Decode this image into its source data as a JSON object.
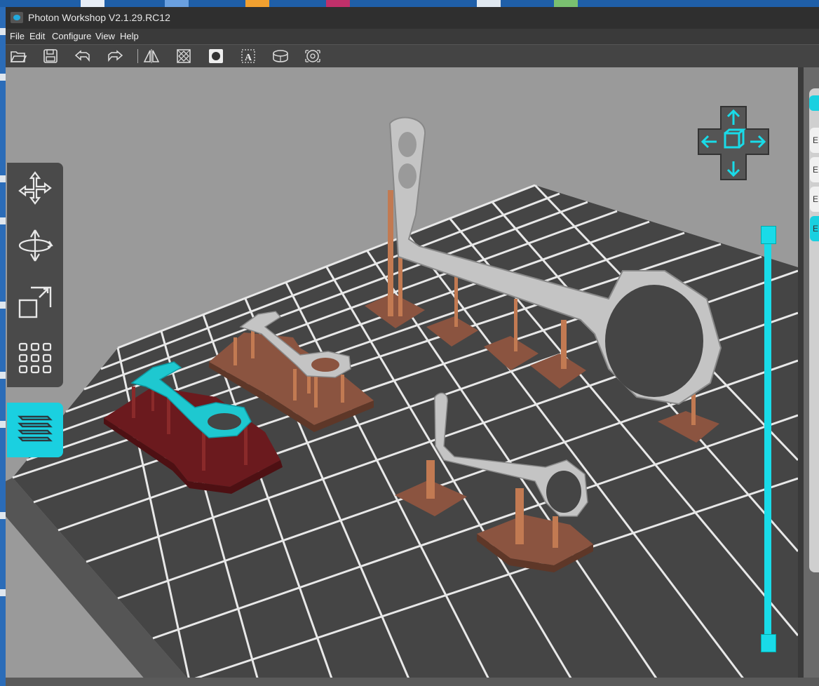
{
  "window": {
    "title": "Photon Workshop V2.1.29.RC12"
  },
  "menu": [
    "File",
    "Edit",
    "Configure",
    "View",
    "Help"
  ],
  "toolbar": [
    {
      "name": "open-icon"
    },
    {
      "name": "save-icon"
    },
    {
      "name": "undo-icon"
    },
    {
      "name": "redo-icon"
    },
    {
      "name": "mirror-icon"
    },
    {
      "name": "hollow-icon"
    },
    {
      "name": "punch-hole-icon"
    },
    {
      "name": "text-icon"
    },
    {
      "name": "slice-icon"
    },
    {
      "name": "support-icon"
    }
  ],
  "left_tools": [
    {
      "name": "move-tool"
    },
    {
      "name": "rotate-tool"
    },
    {
      "name": "scale-tool"
    },
    {
      "name": "arrange-tool"
    }
  ],
  "layers_button": {
    "name": "layers-button"
  },
  "right_panel": {
    "tabs": [
      "E",
      "E",
      "E",
      "E"
    ],
    "active_index": 3
  },
  "colors": {
    "accent": "#19d0e0",
    "grid_plate": "#4a4a4a",
    "viewport_bg": "#9a9a9a",
    "support": "#b8734a",
    "model_gray": "#c4c4c4",
    "model_selected": "#1ec8d0",
    "raft_selected": "#6e1b1f"
  },
  "layer_slider": {
    "top_fraction": 1.0,
    "bottom_fraction": 0.0
  }
}
